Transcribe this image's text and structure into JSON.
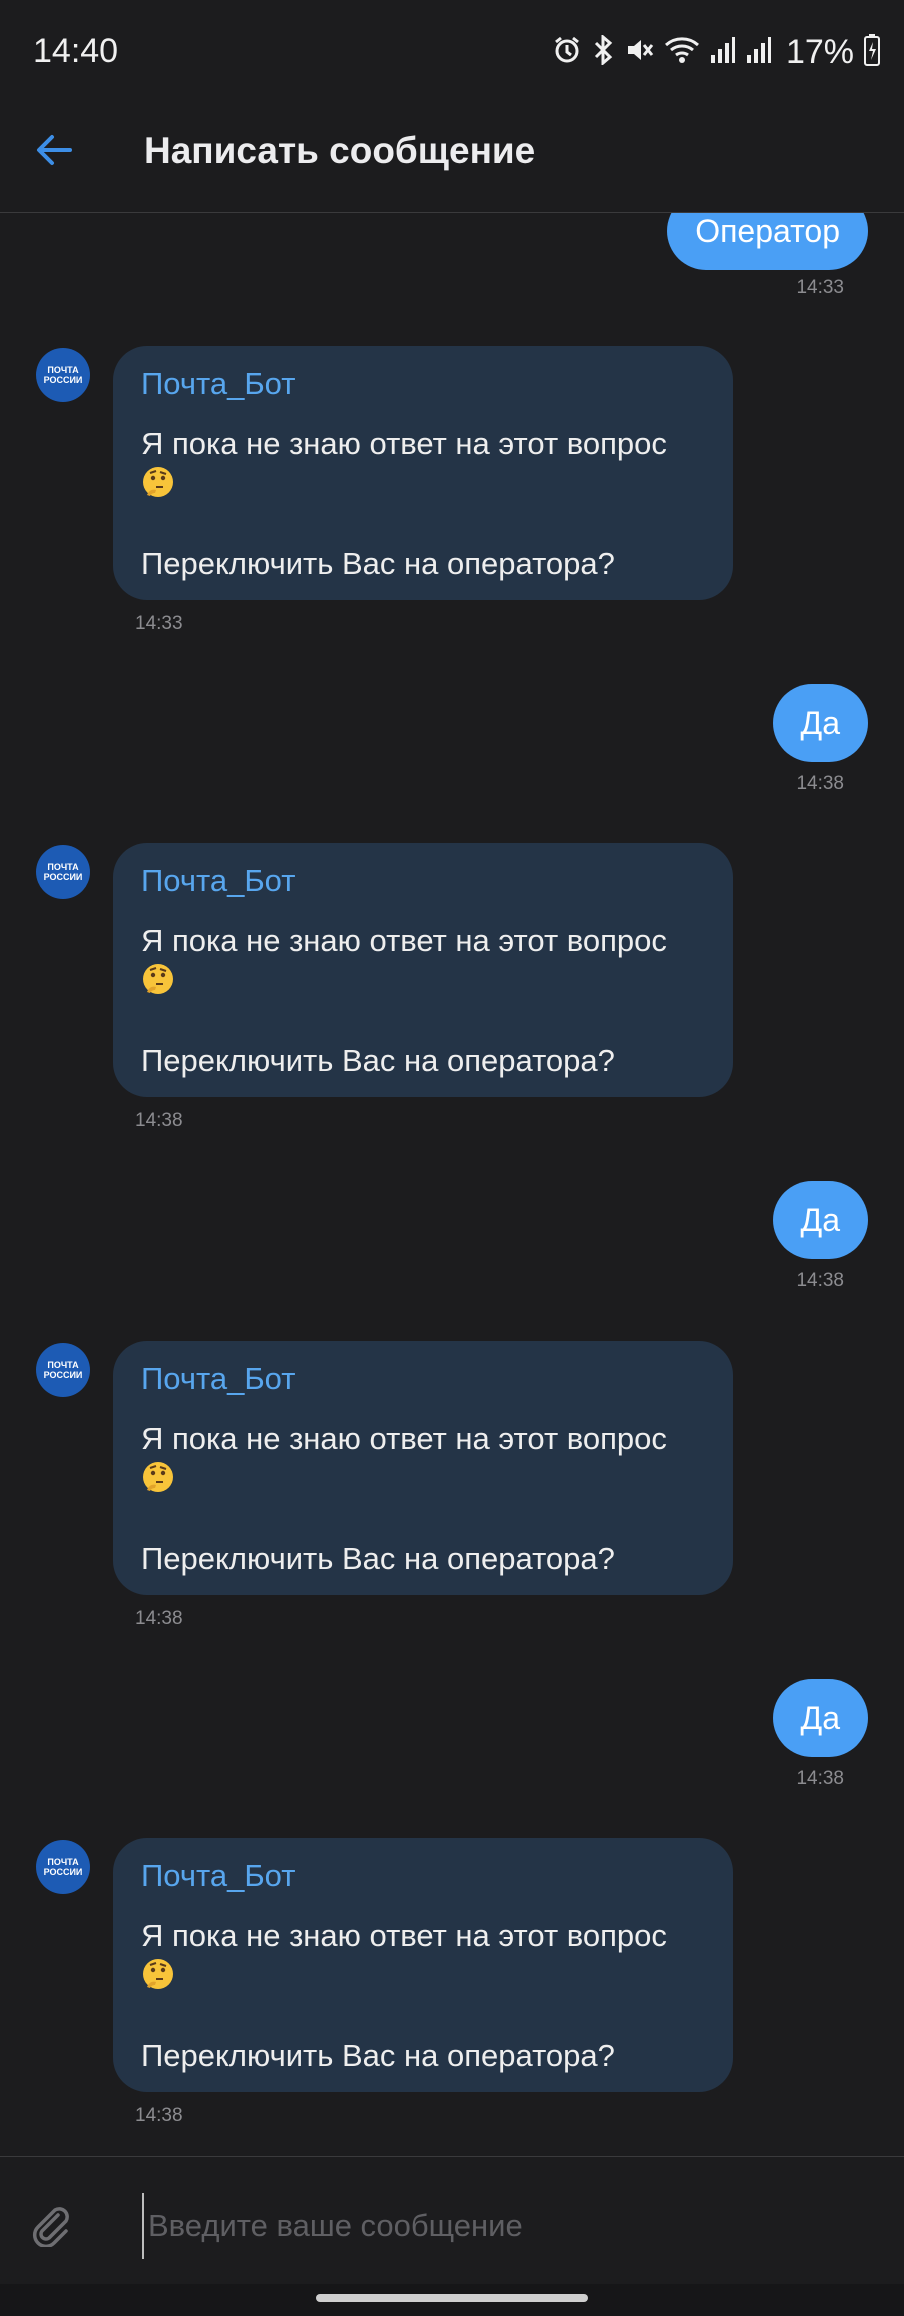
{
  "status_bar": {
    "time": "14:40",
    "battery_percent": "17%",
    "icons": [
      "alarm-icon",
      "bluetooth-icon",
      "mute-icon",
      "wifi-icon",
      "signal-icon",
      "signal-icon",
      "battery-icon"
    ]
  },
  "header": {
    "title": "Написать сообщение",
    "back_icon": "arrow-left-icon"
  },
  "colors": {
    "background": "#1c1c1e",
    "outgoing_bubble": "#4a9ff5",
    "incoming_bubble": "#243447",
    "sender_name": "#58a6ee",
    "accent": "#3d8ee6"
  },
  "bot": {
    "avatar_text": [
      "ПОЧТА",
      "РОССИИ"
    ]
  },
  "messages": [
    {
      "direction": "out",
      "text": "Оператор",
      "time": "14:33"
    },
    {
      "direction": "in",
      "sender": "Почта_Бот",
      "line1": "Я пока не знаю ответ на этот вопрос",
      "emoji": "thinking-face-emoji",
      "line2": "Переключить Вас на оператора?",
      "time": "14:33"
    },
    {
      "direction": "out",
      "text": "Да",
      "time": "14:38"
    },
    {
      "direction": "in",
      "sender": "Почта_Бот",
      "line1": "Я пока не знаю ответ на этот вопрос",
      "emoji": "thinking-face-emoji",
      "line2": "Переключить Вас на оператора?",
      "time": "14:38"
    },
    {
      "direction": "out",
      "text": "Да",
      "time": "14:38"
    },
    {
      "direction": "in",
      "sender": "Почта_Бот",
      "line1": "Я пока не знаю ответ на этот вопрос",
      "emoji": "thinking-face-emoji",
      "line2": "Переключить Вас на оператора?",
      "time": "14:38"
    },
    {
      "direction": "out",
      "text": "Да",
      "time": "14:38"
    },
    {
      "direction": "in",
      "sender": "Почта_Бот",
      "line1": "Я пока не знаю ответ на этот вопрос",
      "emoji": "thinking-face-emoji",
      "line2": "Переключить Вас на оператора?",
      "time": "14:38"
    }
  ],
  "composer": {
    "placeholder": "Введите ваше сообщение",
    "value": "",
    "attach_icon": "paperclip-icon"
  }
}
